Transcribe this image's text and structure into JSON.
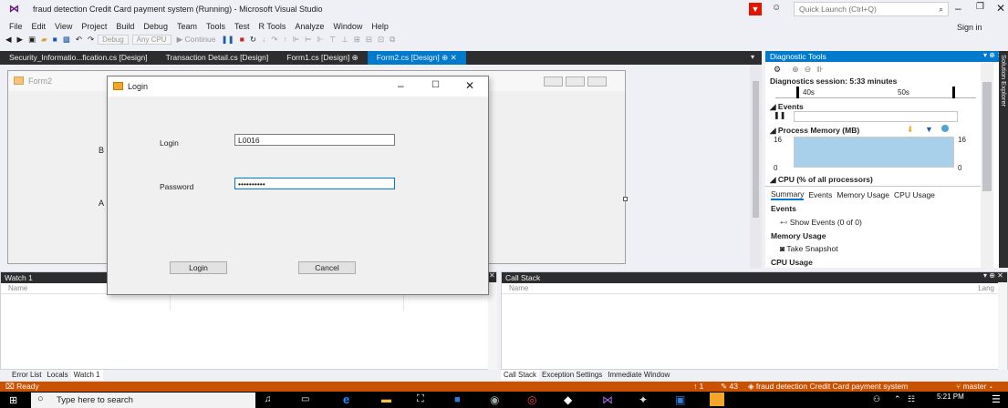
{
  "window": {
    "title": "fraud detection Credit Card payment system (Running) - Microsoft Visual Studio",
    "quick_launch_placeholder": "Quick Launch (Ctrl+Q)",
    "sign_in": "Sign in"
  },
  "menu": [
    "File",
    "Edit",
    "View",
    "Project",
    "Build",
    "Debug",
    "Team",
    "Tools",
    "Test",
    "R Tools",
    "Analyze",
    "Window",
    "Help"
  ],
  "toolbar": {
    "config": "Debug",
    "platform": "Any CPU",
    "continue": "Continue"
  },
  "doc_tabs": [
    {
      "label": "Security_Informatio...fication.cs [Design]"
    },
    {
      "label": "Transaction Detail.cs [Design]"
    },
    {
      "label": "Form1.cs [Design]"
    },
    {
      "label": "Form2.cs [Design]"
    }
  ],
  "designer": {
    "form_title": "Form2",
    "label_b": "B",
    "label_a": "A"
  },
  "login_dialog": {
    "title": "Login",
    "login_label": "Login",
    "login_value": "L0016",
    "password_label": "Password",
    "password_value": "••••••••••",
    "login_button": "Login",
    "cancel_button": "Cancel"
  },
  "watch": {
    "title": "Watch 1",
    "column": "Name",
    "tabs": [
      "Error List",
      "Locals",
      "Watch 1"
    ]
  },
  "call_stack": {
    "title": "Call Stack",
    "column_name": "Name",
    "column_lang": "Lang",
    "tabs": [
      "Call Stack",
      "Exception Settings",
      "Immediate Window"
    ]
  },
  "diagnostic_tools": {
    "title": "Diagnostic Tools",
    "session": "Diagnostics session: 5:33 minutes",
    "tick_40": "40s",
    "tick_50": "50s",
    "events": "Events",
    "process_memory": "Process Memory (MB)",
    "mem_top_left": "16",
    "mem_top_right": "16",
    "mem_bottom_left": "0",
    "mem_bottom_right": "0",
    "cpu": "CPU (% of all processors)",
    "tabs": [
      "Summary",
      "Events",
      "Memory Usage",
      "CPU Usage"
    ],
    "events_section": "Events",
    "show_events": "Show Events (0 of 0)",
    "memory_section": "Memory Usage",
    "take_snapshot": "Take Snapshot",
    "cpu_section": "CPU Usage"
  },
  "solution_explorer": "Solution Explorer",
  "status": {
    "ready": "Ready",
    "up_count": "1",
    "edit_count": "43",
    "project": "fraud detection Credit Card payment system",
    "branch": "master"
  },
  "taskbar": {
    "search_placeholder": "Type here to search",
    "time": "5:21 PM"
  },
  "colors": {
    "accent": "#007acc",
    "status_bar": "#ca5100",
    "dark_tab": "#2d2d30"
  }
}
